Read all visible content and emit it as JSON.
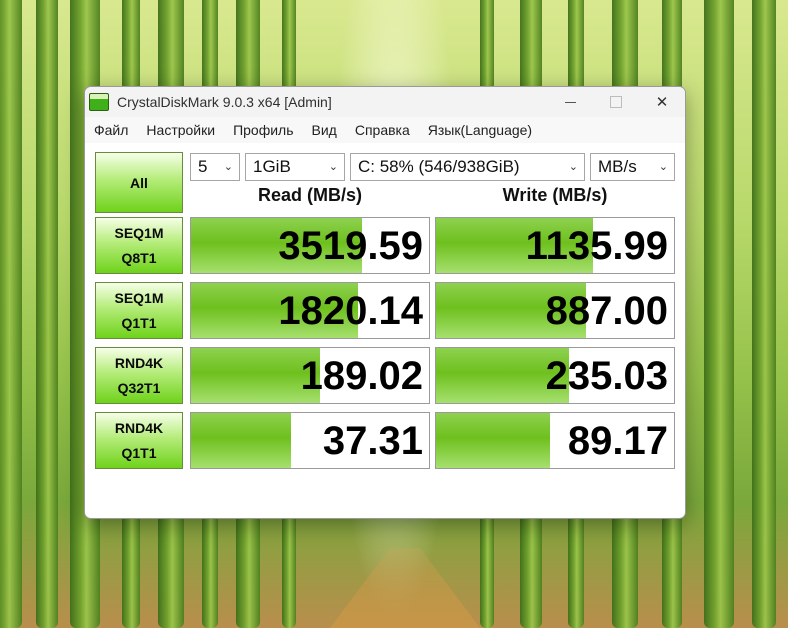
{
  "window": {
    "title": "CrystalDiskMark 9.0.3 x64 [Admin]",
    "minimize": "—",
    "maximize": "",
    "close": "✕"
  },
  "menu": [
    "Файл",
    "Настройки",
    "Профиль",
    "Вид",
    "Справка",
    "Язык(Language)"
  ],
  "controls": {
    "all_label": "All",
    "count": "5",
    "size": "1GiB",
    "drive": "C: 58% (546/938GiB)",
    "unit": "MB/s"
  },
  "headers": {
    "read": "Read (MB/s)",
    "write": "Write (MB/s)"
  },
  "tests": [
    {
      "line1": "SEQ1M",
      "line2": "Q8T1",
      "read": "3519.59",
      "write": "1135.99",
      "read_fill": 0.72,
      "write_fill": 0.66
    },
    {
      "line1": "SEQ1M",
      "line2": "Q1T1",
      "read": "1820.14",
      "write": "887.00",
      "read_fill": 0.7,
      "write_fill": 0.63
    },
    {
      "line1": "RND4K",
      "line2": "Q32T1",
      "read": "189.02",
      "write": "235.03",
      "read_fill": 0.54,
      "write_fill": 0.56
    },
    {
      "line1": "RND4K",
      "line2": "Q1T1",
      "read": "37.31",
      "write": "89.17",
      "read_fill": 0.42,
      "write_fill": 0.48
    }
  ],
  "comment": "",
  "colors": {
    "bar": "#6ec01e",
    "button": "#6fd21b"
  }
}
